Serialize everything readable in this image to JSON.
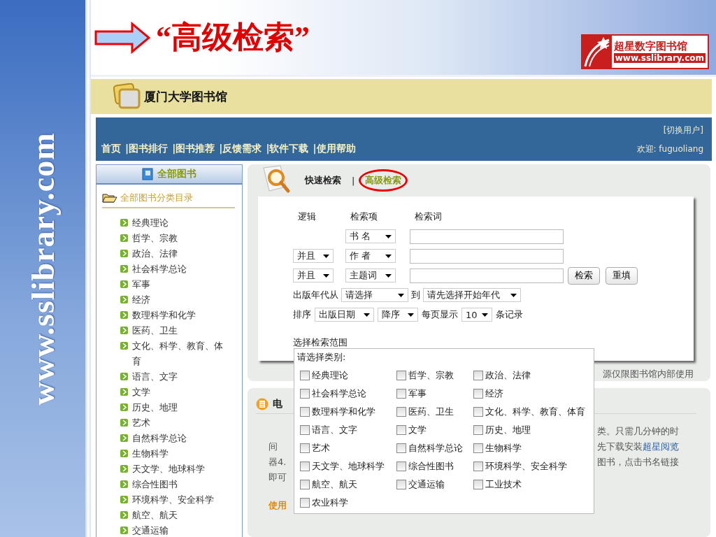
{
  "slide": {
    "title": "“高级检索”",
    "side_text": "www.sslibrary.com",
    "logo": {
      "name": "超星数字图书馆",
      "url": "www.sslibrary.com"
    }
  },
  "site": {
    "name": "厦门大学图书馆",
    "nav": [
      "首页",
      "|图书排行",
      "|图书推荐",
      "|反馈需求",
      "|软件下载",
      "|使用帮助"
    ],
    "switch_user": "[切换用户]",
    "welcome": "欢迎: fuguoliang"
  },
  "sidebar": {
    "title": "全部图书",
    "catalog": "全部图书分类目录",
    "items": [
      "经典理论",
      "哲学、宗教",
      "政治、法律",
      "社会科学总论",
      "军事",
      "经济",
      "数理科学和化学",
      "医药、卫生",
      "文化、科学、教育、体育",
      "语言、文字",
      "文学",
      "历史、地理",
      "艺术",
      "自然科学总论",
      "生物科学",
      "天文学、地球科学",
      "综合性图书",
      "环境科学、安全科学",
      "航空、航天",
      "交通运输"
    ]
  },
  "search": {
    "tabs": [
      {
        "label": "快速检索",
        "selected": false
      },
      {
        "label": "高级检索",
        "selected": true
      }
    ],
    "tab_separator": "|",
    "form": {
      "headers": [
        "逻辑",
        "检索项",
        "检索词"
      ],
      "rows": [
        {
          "field": "书 名"
        },
        {
          "logic": "并且",
          "field": "作 者"
        },
        {
          "logic": "并且",
          "field": "主题词"
        }
      ],
      "buttons": [
        "检索",
        "重填"
      ],
      "year_label": "出版年代从",
      "year_from": "请选择",
      "to_label": "到",
      "year_to": "请先选择开始年代",
      "sort_label": "排序",
      "sort_by": "出版日期",
      "order": "降序",
      "per_page_label": "每页显示",
      "per_page": "10",
      "records_label": "条记录",
      "scope_label": "选择检索范围"
    },
    "note": "源仅限图书馆内部使用"
  },
  "ebook_panel": {
    "heading": "电",
    "left_lines": [
      "间",
      "器4.",
      "即可"
    ],
    "right_lines": [
      "类。只需几分钟的时",
      "先下载安装",
      "图书，点击书名链接"
    ],
    "link": "超星阅览",
    "footer": "使用"
  },
  "popup": {
    "title": "请选择类别:",
    "categories": [
      {
        "label": "经典理论",
        "checked": false
      },
      {
        "label": "哲学、宗教",
        "checked": false
      },
      {
        "label": "政治、法律",
        "checked": false
      },
      {
        "label": "社会科学总论",
        "checked": false
      },
      {
        "label": "军事",
        "checked": false
      },
      {
        "label": "经济",
        "checked": false
      },
      {
        "label": "数理科学和化学",
        "checked": false
      },
      {
        "label": "医药、卫生",
        "checked": false
      },
      {
        "label": "文化、科学、教育、体育",
        "checked": false
      },
      {
        "label": "语言、文字",
        "checked": false
      },
      {
        "label": "文学",
        "checked": false
      },
      {
        "label": "历史、地理",
        "checked": false
      },
      {
        "label": "艺术",
        "checked": false
      },
      {
        "label": "自然科学总论",
        "checked": false
      },
      {
        "label": "生物科学",
        "checked": false
      },
      {
        "label": "天文学、地球科学",
        "checked": false
      },
      {
        "label": "综合性图书",
        "checked": false
      },
      {
        "label": "环境科学、安全科学",
        "checked": false
      },
      {
        "label": "航空、航天",
        "checked": false
      },
      {
        "label": "交通运输",
        "checked": false
      },
      {
        "label": "工业技术",
        "checked": false
      },
      {
        "label": "农业科学",
        "checked": false
      }
    ]
  }
}
